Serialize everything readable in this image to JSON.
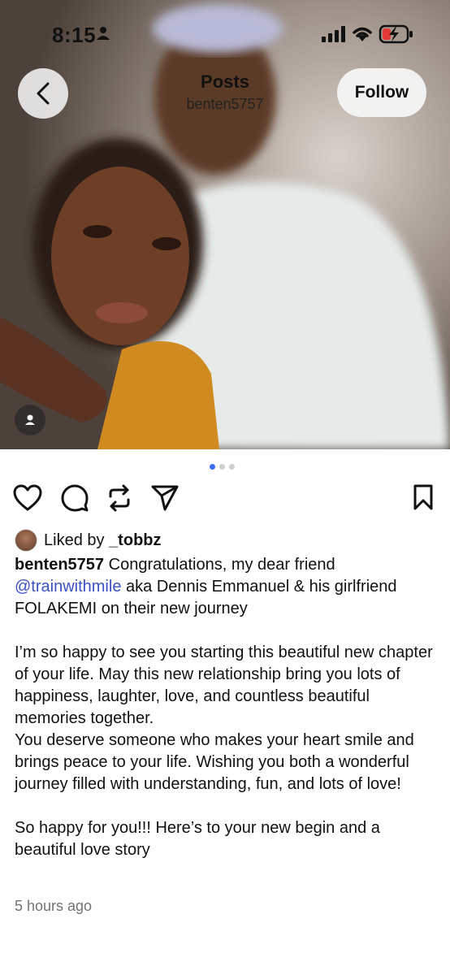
{
  "status_bar": {
    "time": "8:15"
  },
  "header": {
    "title": "Posts",
    "username": "benten5757",
    "follow_label": "Follow"
  },
  "carousel": {
    "total": 3,
    "active": 0
  },
  "liked": {
    "prefix": "Liked by",
    "user": "_tobbz"
  },
  "caption": {
    "username": "benten5757",
    "line1_before": "Congratulations, my dear friend",
    "mention": "@trainwithmile",
    "line1_after": "aka Dennis Emmanuel & his girlfriend FOLAKEMI on their new journey",
    "para2": "I’m so happy to see you starting this beautiful new chapter of your life. May this new relationship bring you lots of happiness, laughter, love, and countless beautiful memories together.",
    "para3": "You deserve someone who makes your heart smile and brings peace to your life. Wishing you both a wonderful journey filled with understanding, fun, and lots of love!",
    "para4": "So happy for you!!! Here’s to your new begin and a beautiful love story"
  },
  "timestamp": "5 hours ago",
  "icons": {
    "like": "heart-icon",
    "comment": "comment-icon",
    "repost": "repost-icon",
    "share": "share-icon",
    "save": "bookmark-icon",
    "tagged": "person-tag-icon"
  },
  "colors": {
    "mention": "#3a52c4",
    "carousel_active": "#3b6cf6",
    "muted": "#737373"
  }
}
